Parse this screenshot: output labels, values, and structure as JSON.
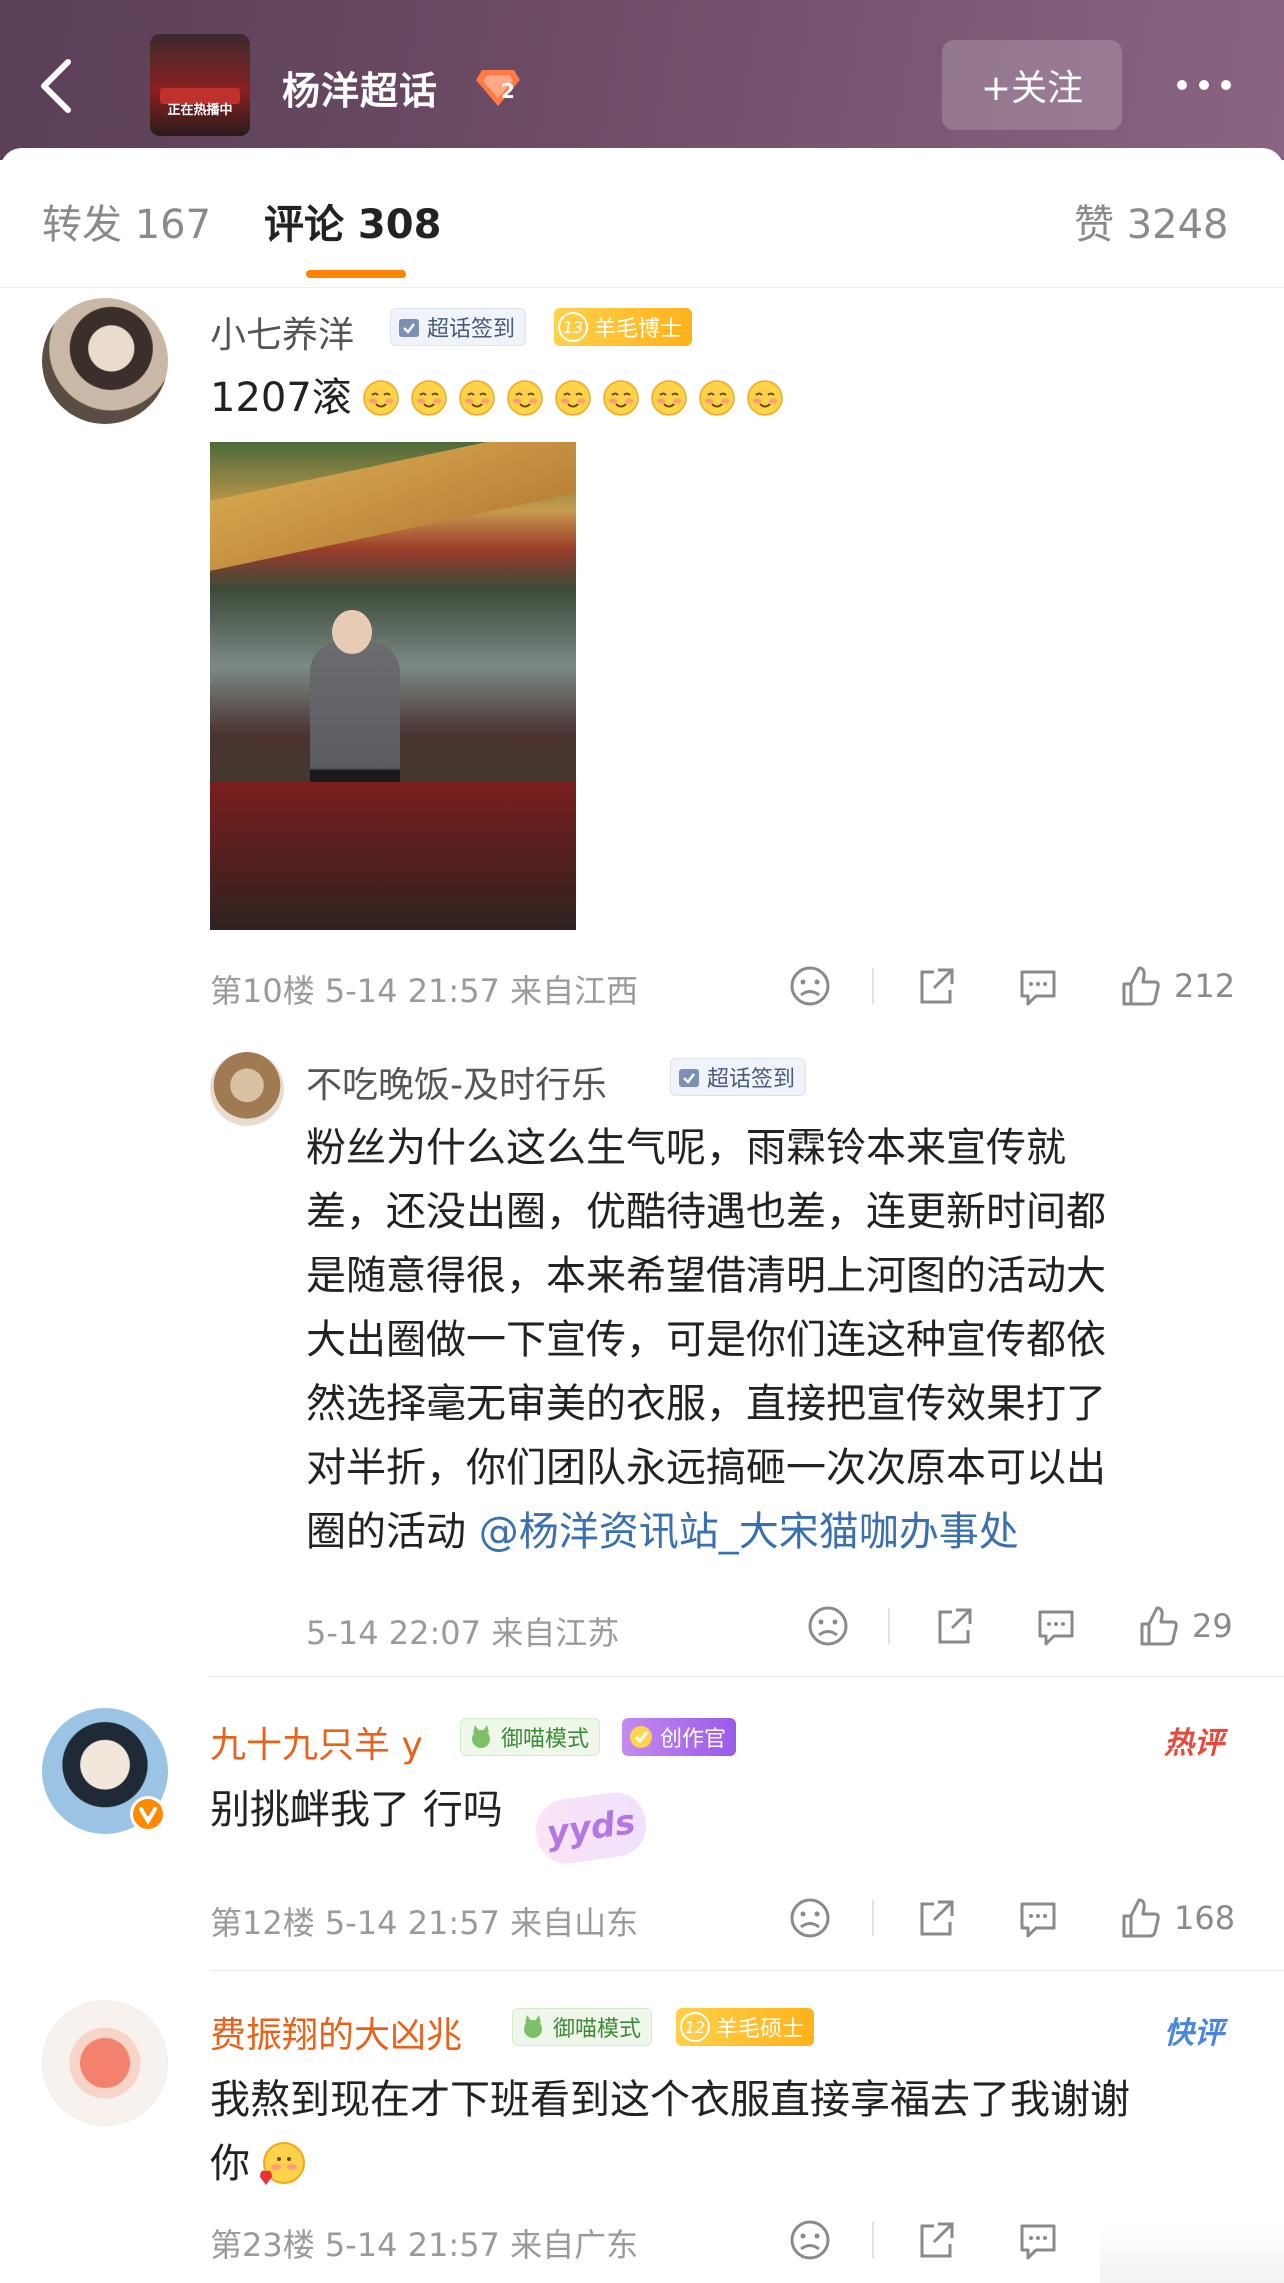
{
  "header": {
    "title": "杨洋超话",
    "level": "2",
    "follow_label": "+关注",
    "cover_caption": "正在热播中"
  },
  "tabs": [
    {
      "label": "转发 167"
    },
    {
      "label": "评论 308"
    },
    {
      "label": "赞 3248"
    }
  ],
  "comments": [
    {
      "user": "小七养洋",
      "tags": [
        "超话签到",
        "13",
        "羊毛博士"
      ],
      "text": "1207滚",
      "emoji_count": 9,
      "floor": "第10楼 5-14 21:57 来自江西",
      "likes": "212"
    },
    {
      "user": "不吃晚饭-及时行乐",
      "tags": [
        "超话签到"
      ],
      "lines": [
        "粉丝为什么这么生气呢，雨霖铃本来宣传就",
        "差，还没出圈，优酷待遇也差，连更新时间都",
        "是随意得很，本来希望借清明上河图的活动大",
        "大出圈做一下宣传，可是你们连这种宣传都依",
        "然选择毫无审美的衣服，直接把宣传效果打了",
        "对半折，你们团队永远搞砸一次次原本可以出"
      ],
      "last_line_prefix": "圈的活动 ",
      "mention": "@杨洋资讯站_大宋猫咖办事处",
      "floor": "5-14 22:07 来自江苏",
      "likes": "29"
    },
    {
      "user": "九十九只羊 y",
      "tags": [
        "御喵模式",
        "创作官"
      ],
      "badge": "热评",
      "text": "别挑衅我了 行吗",
      "sticker": "yyds",
      "floor": "第12楼 5-14 21:57 来自山东",
      "likes": "168"
    },
    {
      "user": "费振翔的大凶兆",
      "tags": [
        "御喵模式",
        "12",
        "羊毛硕士"
      ],
      "badge": "快评",
      "lines": [
        "我熬到现在才下班看到这个衣服直接享福去了我谢谢",
        "你"
      ],
      "floor": "第23楼 5-14 21:57 来自广东"
    }
  ],
  "colors": {
    "accent": "#ff8200",
    "header": "#6e4c66",
    "mention": "#3a6fb0",
    "vip_name": "#e8621a"
  }
}
